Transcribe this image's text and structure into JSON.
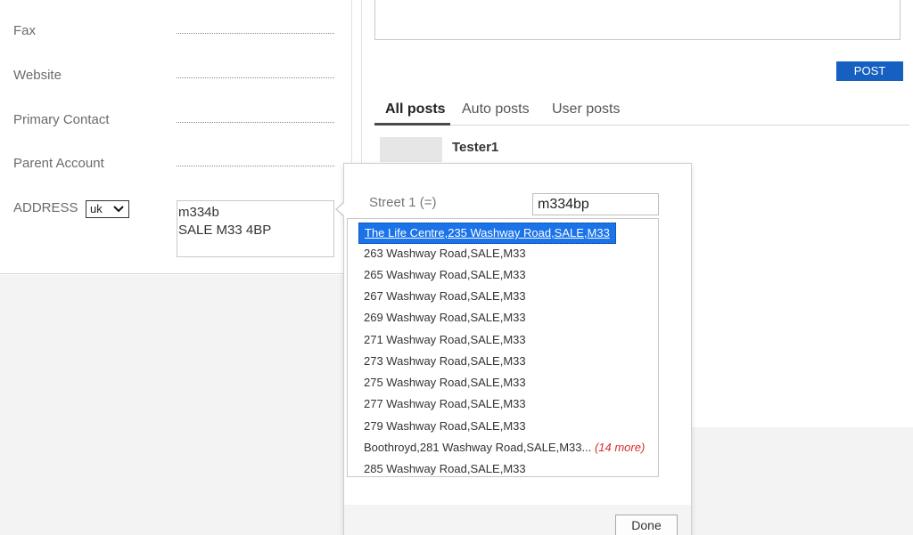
{
  "form": {
    "fields": [
      {
        "label": "Fax"
      },
      {
        "label": "Website"
      },
      {
        "label": "Primary Contact"
      },
      {
        "label": "Parent Account"
      }
    ],
    "address": {
      "label": "ADDRESS",
      "country_value": "uk",
      "line1": "m334b",
      "line2": "SALE M33 4BP"
    }
  },
  "posts": {
    "post_button": "POST",
    "tabs": [
      "All posts",
      "Auto posts",
      "User posts"
    ],
    "first_post_author": "Tester1"
  },
  "lookup": {
    "field_label": "Street 1 (=)",
    "search_value": "m334bp",
    "results": [
      {
        "text": "The Life Centre,235 Washway Road,SALE,M33",
        "selected": true
      },
      {
        "text": "263 Washway Road,SALE,M33"
      },
      {
        "text": "265 Washway Road,SALE,M33"
      },
      {
        "text": "267 Washway Road,SALE,M33"
      },
      {
        "text": "269 Washway Road,SALE,M33"
      },
      {
        "text": "271 Washway Road,SALE,M33"
      },
      {
        "text": "273 Washway Road,SALE,M33"
      },
      {
        "text": "275 Washway Road,SALE,M33"
      },
      {
        "text": "277 Washway Road,SALE,M33"
      },
      {
        "text": "279 Washway Road,SALE,M33"
      },
      {
        "text": "Boothroyd,281 Washway Road,SALE,M33...",
        "more": "(14 more)"
      },
      {
        "text": "285 Washway Road,SALE,M33"
      }
    ],
    "done_label": "Done"
  },
  "colors": {
    "accent": "#1660c2",
    "selection": "#1a73e8",
    "more_text": "#d92b2b"
  }
}
